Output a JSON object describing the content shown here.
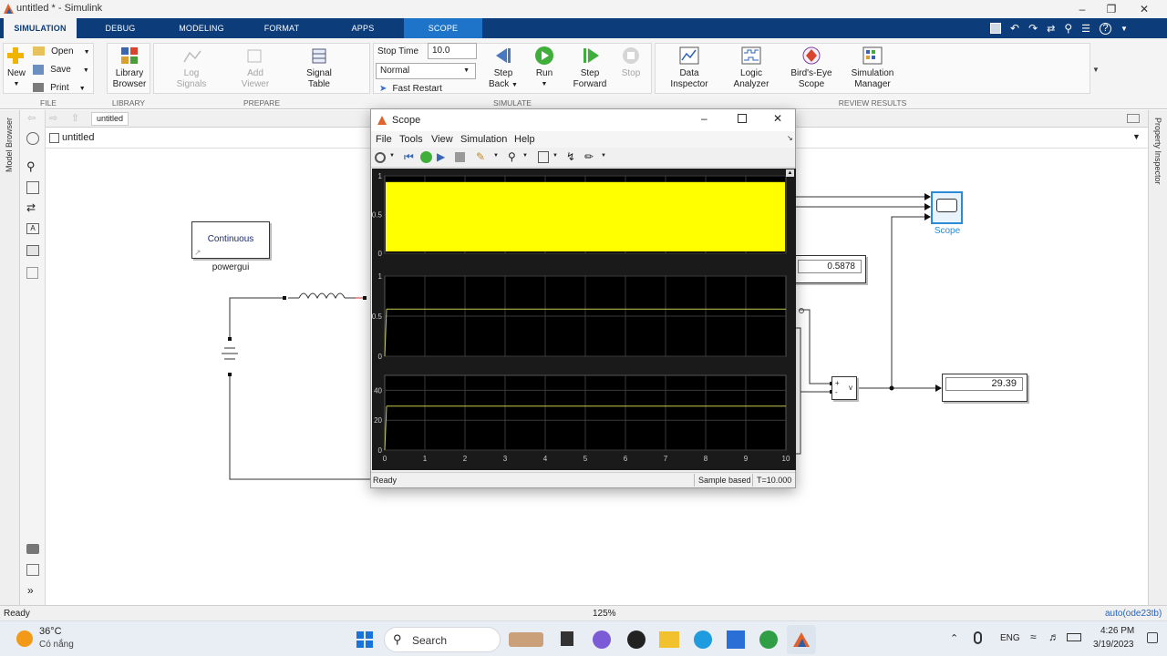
{
  "window": {
    "title": "untitled * - Simulink"
  },
  "tabs": [
    "SIMULATION",
    "DEBUG",
    "MODELING",
    "FORMAT",
    "APPS",
    "SCOPE"
  ],
  "ribbon": {
    "file": {
      "new": "New",
      "open": "Open",
      "save": "Save",
      "print": "Print",
      "label": "FILE"
    },
    "library": {
      "browser_l1": "Library",
      "browser_l2": "Browser",
      "label": "LIBRARY"
    },
    "prepare": {
      "log_l1": "Log",
      "log_l2": "Signals",
      "add_l1": "Add",
      "add_l2": "Viewer",
      "sig_l1": "Signal",
      "sig_l2": "Table",
      "label": "PREPARE"
    },
    "simulate": {
      "stop_time_label": "Stop Time",
      "stop_time_value": "10.0",
      "mode": "Normal",
      "fast_restart": "Fast Restart",
      "step_back_l1": "Step",
      "step_back_l2": "Back",
      "run": "Run",
      "step_fwd_l1": "Step",
      "step_fwd_l2": "Forward",
      "stop": "Stop",
      "label": "SIMULATE"
    },
    "review": {
      "data_l1": "Data",
      "data_l2": "Inspector",
      "logic_l1": "Logic",
      "logic_l2": "Analyzer",
      "birds_l1": "Bird's-Eye",
      "birds_l2": "Scope",
      "simmgr_l1": "Simulation",
      "simmgr_l2": "Manager",
      "label": "REVIEW RESULTS"
    }
  },
  "side": {
    "model_browser": "Model Browser",
    "property_inspector": "Property Inspector"
  },
  "nav": {
    "tab": "untitled",
    "breadcrumb": "untitled"
  },
  "canvas": {
    "powergui_text": "Continuous",
    "powergui_label": "powergui",
    "scope_label": "Scope",
    "display1": "0.5878",
    "display2": "29.39",
    "vm_plus": "+",
    "vm_minus": "-",
    "vm_v": "v"
  },
  "scope": {
    "title": "Scope",
    "menu": [
      "File",
      "Tools",
      "View",
      "Simulation",
      "Help"
    ],
    "status_left": "Ready",
    "status_mode": "Sample based",
    "status_time": "T=10.000"
  },
  "plots": [
    {
      "yticks": [
        "1",
        "0.5",
        "0"
      ],
      "ylim": [
        0,
        1
      ],
      "value": 0.92,
      "fill": "#ffff00"
    },
    {
      "yticks": [
        "1",
        "0.5",
        "0"
      ],
      "ylim": [
        0,
        1
      ],
      "value": 0.5878,
      "line": "#c8c850"
    },
    {
      "yticks": [
        "40",
        "20",
        "0"
      ],
      "ylim": [
        0,
        50
      ],
      "value": 29.39,
      "line": "#c8c850"
    }
  ],
  "xticks": [
    "0",
    "1",
    "2",
    "3",
    "4",
    "5",
    "6",
    "7",
    "8",
    "9",
    "10"
  ],
  "status": {
    "left": "Ready",
    "zoom": "125%",
    "solver": "auto(ode23tb)"
  },
  "taskbar": {
    "weather_temp": "36°C",
    "weather_desc": "Có nắng",
    "search": "Search",
    "lang": "ENG",
    "time": "4:26 PM",
    "date": "3/19/2023"
  }
}
